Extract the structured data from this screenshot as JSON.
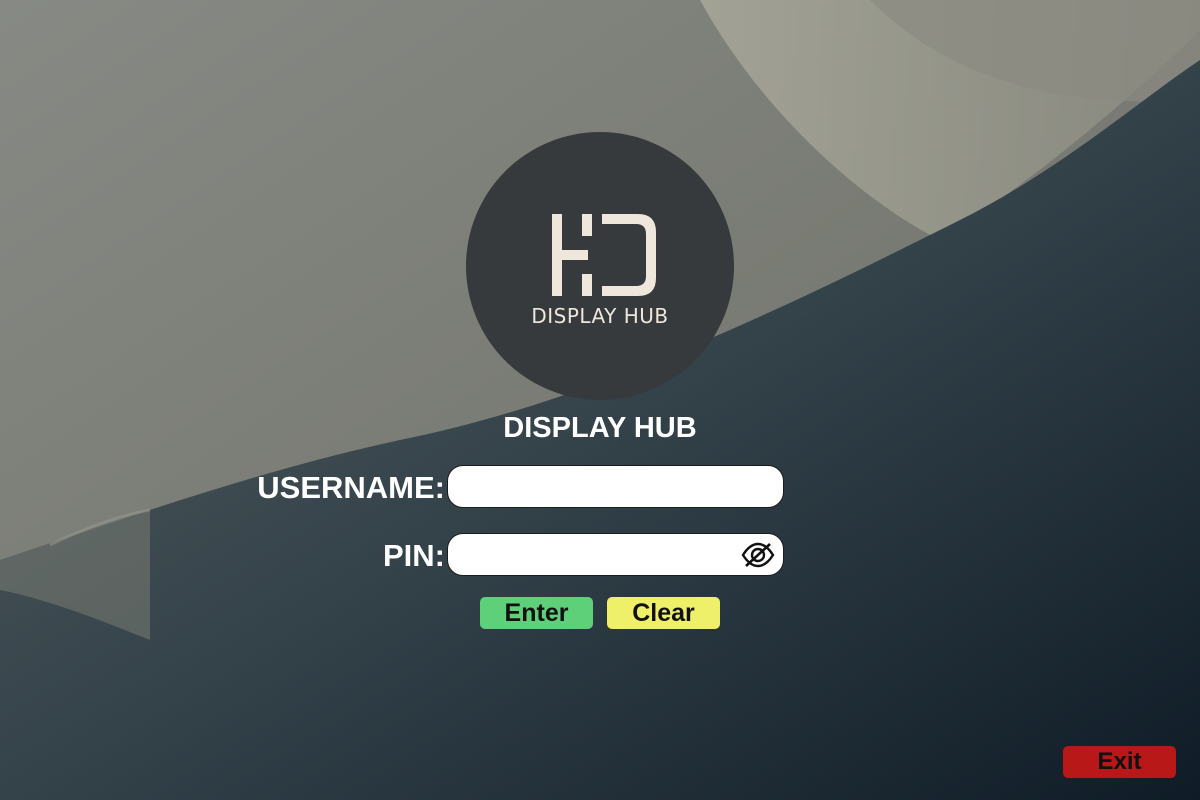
{
  "logo": {
    "icon": "display-hub-hd-logo",
    "wordmark": "DISPLAY HUB"
  },
  "app_title": "DISPLAY HUB",
  "form": {
    "username_label": "USERNAME:",
    "username_value": "",
    "pin_label": "PIN:",
    "pin_value": "",
    "pin_toggle_icon": "eye-off-icon"
  },
  "buttons": {
    "enter": "Enter",
    "clear": "Clear",
    "exit": "Exit"
  },
  "colors": {
    "enter": "#5ed07a",
    "clear": "#eef06a",
    "exit": "#b81818",
    "logo_circle": "#363a3d"
  }
}
